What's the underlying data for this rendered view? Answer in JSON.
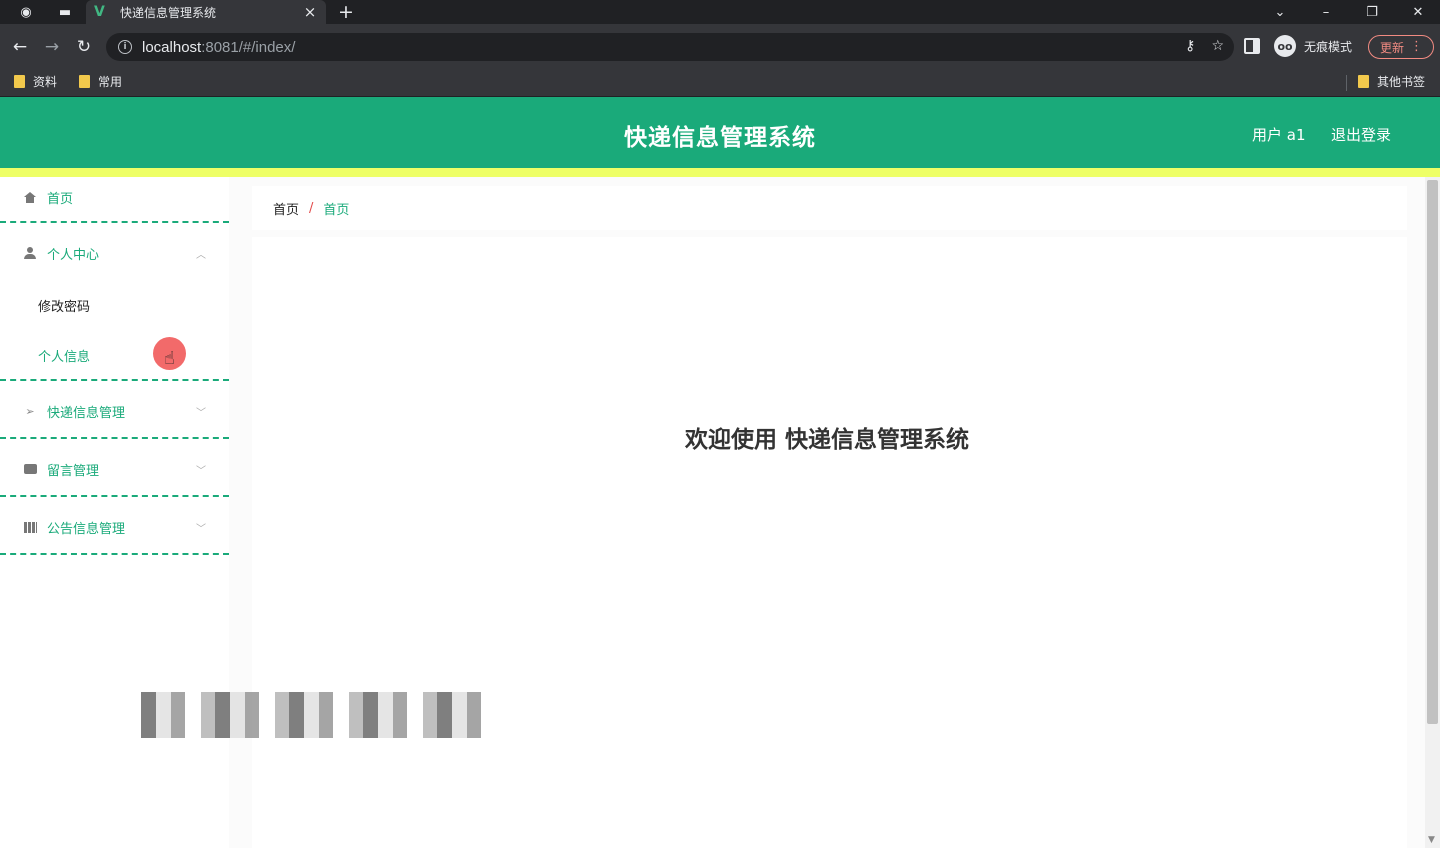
{
  "browser": {
    "tab_title": "快递信息管理系统",
    "tab_close": "×",
    "new_tab": "+",
    "url_host": "localhost",
    "url_rest": ":8081/#/index/",
    "incognito_label": "无痕模式",
    "update_label": "更新",
    "bookmarks": [
      "资料",
      "常用"
    ],
    "other_bookmarks": "其他书签"
  },
  "header": {
    "title": "快递信息管理系统",
    "user": "用户 a1",
    "logout": "退出登录"
  },
  "sidebar": {
    "home": "首页",
    "personal_center": "个人中心",
    "change_password": "修改密码",
    "personal_info": "个人信息",
    "express_mgmt": "快递信息管理",
    "message_mgmt": "留言管理",
    "notice_mgmt": "公告信息管理"
  },
  "breadcrumb": {
    "first": "首页",
    "separator": "/",
    "current": "首页"
  },
  "main": {
    "welcome": "欢迎使用 快递信息管理系统"
  },
  "colors": {
    "primary": "#1aaa7a",
    "accent_strip": "#eeff66",
    "breadcrumb_separator": "#e24a4a"
  }
}
